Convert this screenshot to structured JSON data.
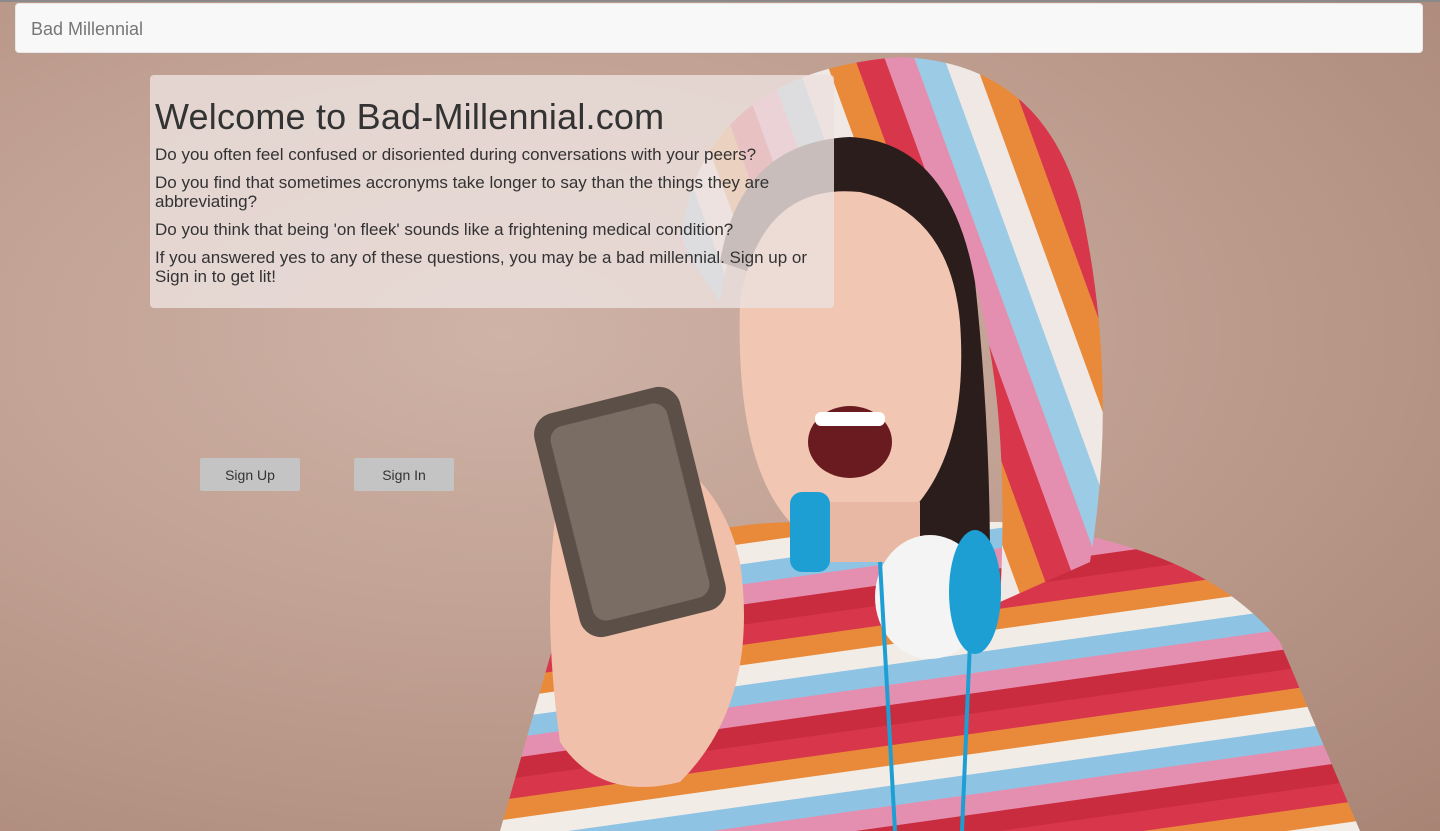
{
  "navbar": {
    "brand": "Bad Millennial"
  },
  "intro": {
    "heading": "Welcome to Bad-Millennial.com",
    "questions": [
      "Do you often feel confused or disoriented during conversations with your peers?",
      "Do you find that sometimes accronyms take longer to say than the things they are abbreviating?",
      "Do you think that being 'on fleek' sounds like a frightening medical condition?",
      "If you answered yes to any of these questions, you may be a bad millennial. Sign up or Sign in to get lit!"
    ]
  },
  "actions": {
    "signup_label": "Sign Up",
    "signin_label": "Sign In"
  },
  "hero": {
    "image_subject": "woman-in-striped-hoodie-shouting-at-phone"
  },
  "colors": {
    "navbar_bg": "#f8f8f8",
    "brand_text": "#777777",
    "panel_bg": "#ebe1de",
    "button_bg": "#c4c4c4",
    "body_text": "#333333"
  }
}
